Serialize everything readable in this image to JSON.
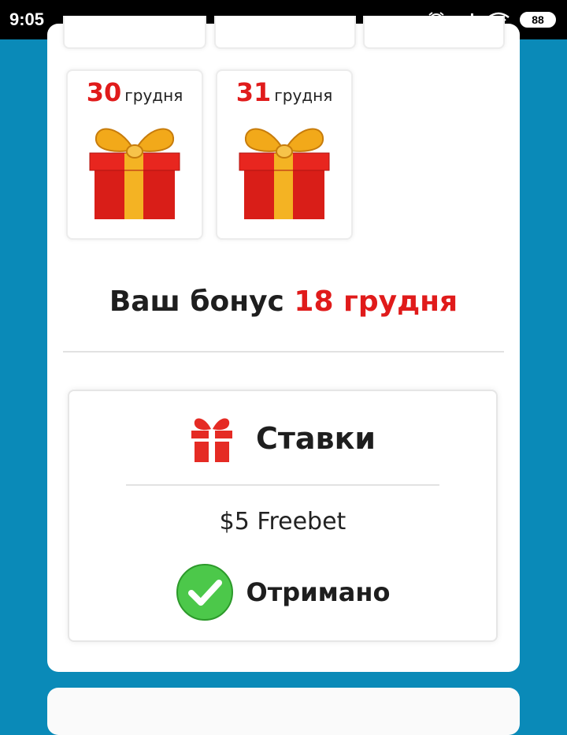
{
  "status_bar": {
    "time": "9:05",
    "battery": "88",
    "icons": [
      "alarm-icon",
      "signal-icon",
      "wifi-icon",
      "battery-icon"
    ]
  },
  "days": [
    {
      "number": "30",
      "month": "грудня"
    },
    {
      "number": "31",
      "month": "грудня"
    }
  ],
  "bonus": {
    "prefix": "Ваш бонус",
    "date": "18 грудня"
  },
  "bets_card": {
    "title": "Ставки",
    "prize": "$5 Freebet",
    "status": "Отримано"
  },
  "colors": {
    "accent_red": "#e01b1b",
    "background_blue": "#0a8ab8",
    "check_green": "#4cc84a"
  }
}
